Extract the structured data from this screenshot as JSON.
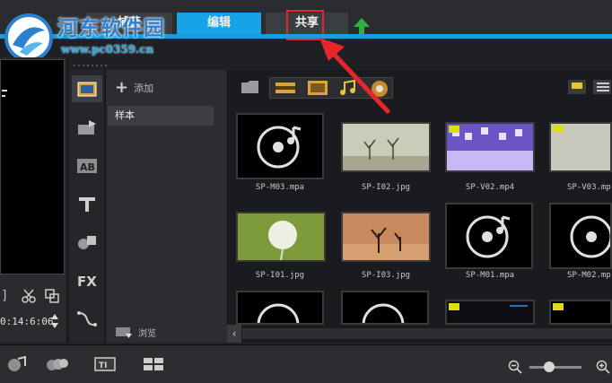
{
  "header": {
    "tabs": [
      {
        "label": "捕获",
        "active": false
      },
      {
        "label": "编辑",
        "active": true
      },
      {
        "label": "共享",
        "active": false
      }
    ],
    "upload_icon": "upload-arrow-icon",
    "accent_color": "#1f9bd9",
    "highlight_color": "#e7262b"
  },
  "watermark": {
    "name": "河东软件园",
    "url": "www.pc0359.cn"
  },
  "preview": {
    "timecode": "0:14:6:06"
  },
  "folders": {
    "add_label": "添加",
    "items": [
      "样本"
    ],
    "browse_label": "浏览"
  },
  "library": {
    "clips": [
      {
        "name": "SP-M03.mpa",
        "kind": "audio"
      },
      {
        "name": "SP-I02.jpg",
        "kind": "image-trees"
      },
      {
        "name": "SP-V02.mp4",
        "kind": "video-purple"
      },
      {
        "name": "SP-V03.mp",
        "kind": "video-gray"
      },
      {
        "name": "SP-I01.jpg",
        "kind": "image-dandelion"
      },
      {
        "name": "SP-I03.jpg",
        "kind": "image-desert"
      },
      {
        "name": "SP-M01.mpa",
        "kind": "audio"
      },
      {
        "name": "SP-M02.mp",
        "kind": "audio"
      },
      {
        "name": "",
        "kind": "audio"
      },
      {
        "name": "",
        "kind": "audio"
      },
      {
        "name": "",
        "kind": "video-dark"
      },
      {
        "name": "",
        "kind": "video-dark"
      }
    ]
  }
}
